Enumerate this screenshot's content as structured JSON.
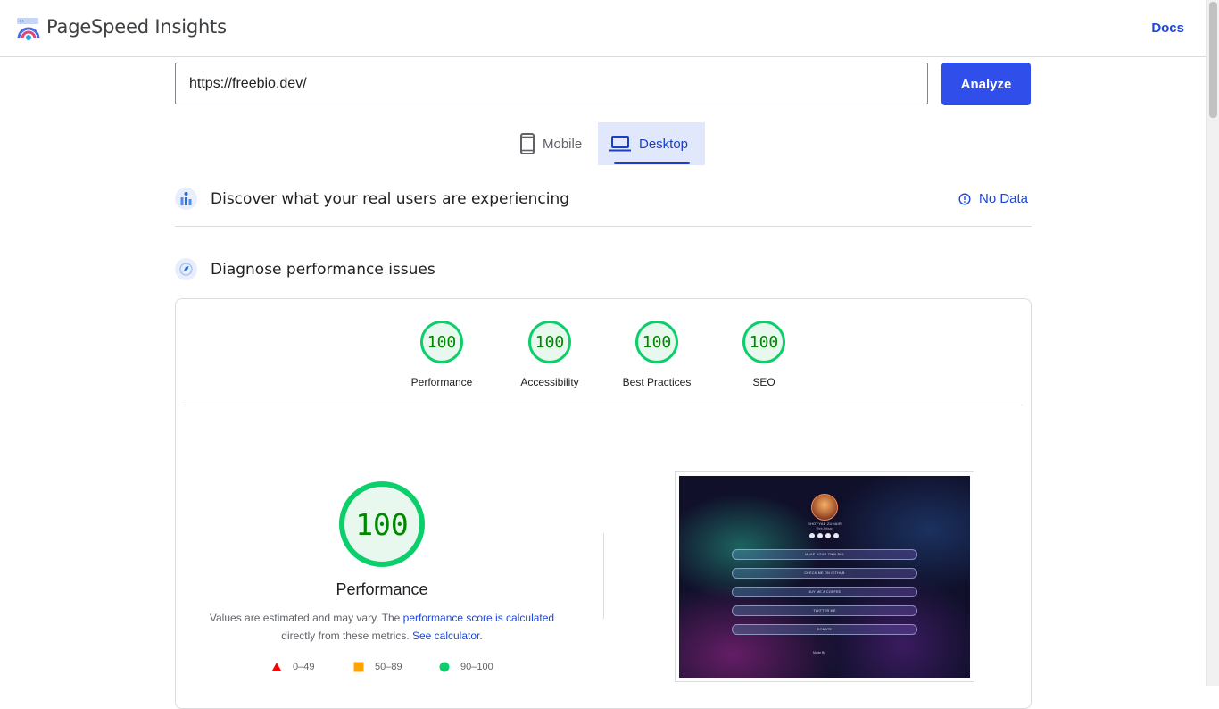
{
  "app": {
    "title": "PageSpeed Insights",
    "docs_label": "Docs"
  },
  "search": {
    "url_value": "https://freebio.dev/",
    "analyze_label": "Analyze"
  },
  "tabs": [
    {
      "label": "Mobile",
      "icon": "phone-icon",
      "selected": false
    },
    {
      "label": "Desktop",
      "icon": "laptop-icon",
      "selected": true
    }
  ],
  "field_data": {
    "title": "Discover what your real users are experiencing",
    "status": "No Data"
  },
  "diagnose": {
    "title": "Diagnose performance issues"
  },
  "categories": [
    {
      "label": "Performance",
      "score": "100"
    },
    {
      "label": "Accessibility",
      "score": "100"
    },
    {
      "label": "Best Practices",
      "score": "100"
    },
    {
      "label": "SEO",
      "score": "100"
    }
  ],
  "performance": {
    "score": "100",
    "label": "Performance",
    "desc_prefix": "Values are estimated and may vary. The ",
    "desc_link": "performance score is calculated",
    "desc_middle": " directly from these metrics. ",
    "calc_link": "See calculator."
  },
  "legend": [
    {
      "range": "0–49",
      "shape": "triangle",
      "color": "#ff0000"
    },
    {
      "range": "50–89",
      "shape": "square",
      "color": "#ffa400"
    },
    {
      "range": "90–100",
      "shape": "circle",
      "color": "#0cce6b"
    }
  ],
  "preview": {
    "name": "SHOYYAB ZUHAIR",
    "subtitle": "Web Artisan",
    "buttons": [
      "MAKE YOUR OWN BIO",
      "CHECK ME ON GITHUB",
      "BUY ME A COFFEE",
      "TWITTER ME",
      "DONATE"
    ],
    "footer": "Made By"
  },
  "colors": {
    "accent": "#2f4eea",
    "pass": "#0cce6b",
    "link": "#1a47d8"
  }
}
